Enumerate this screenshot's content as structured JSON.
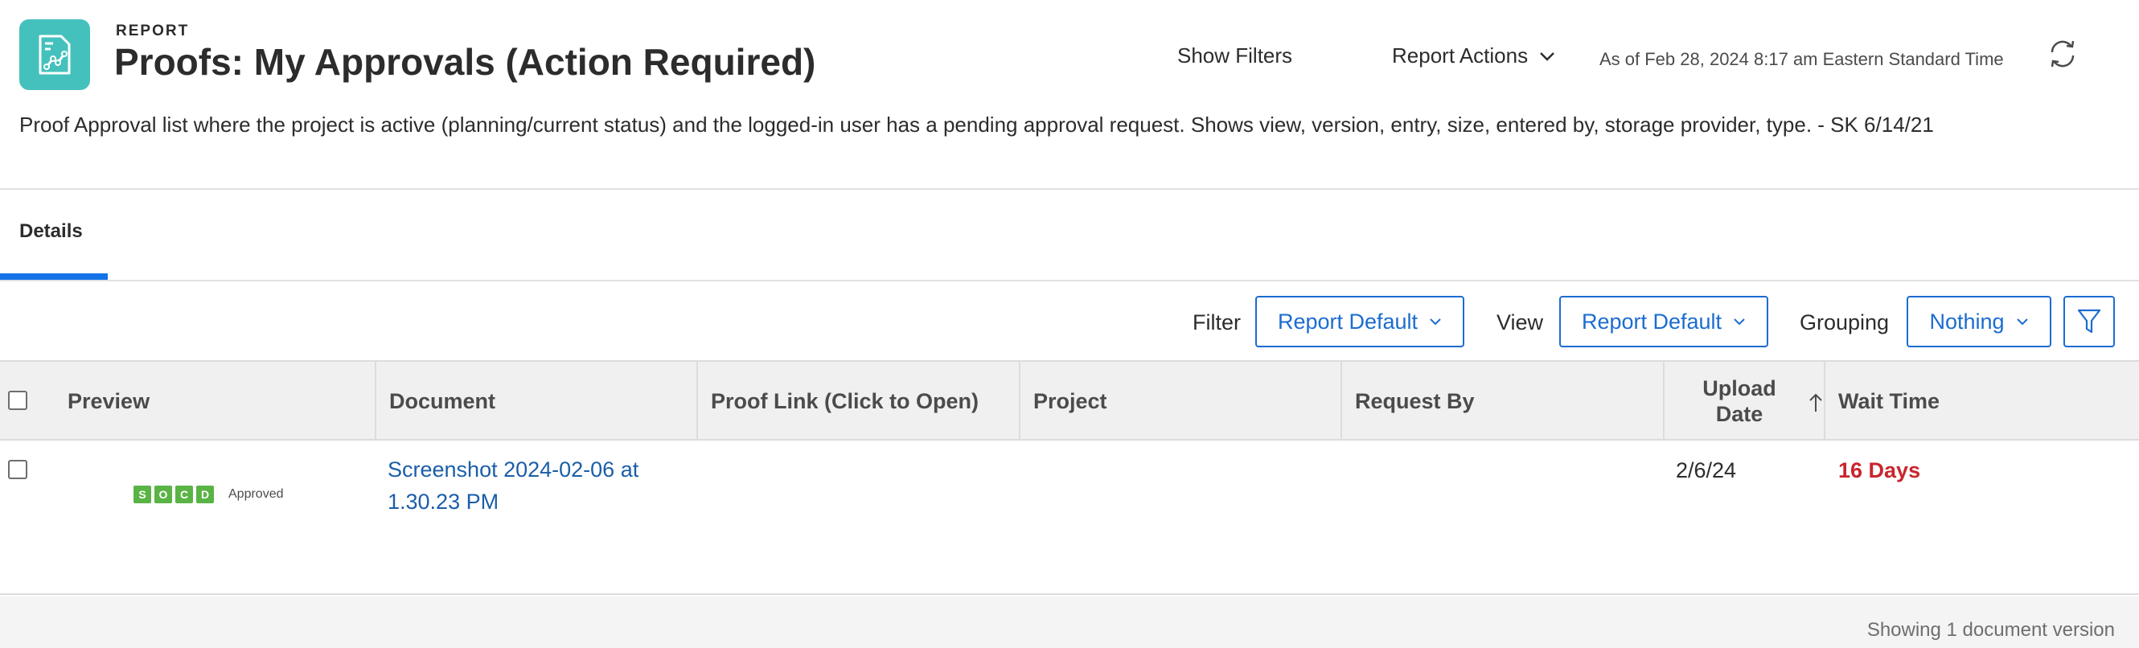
{
  "header": {
    "eyebrow": "REPORT",
    "title": "Proofs: My Approvals (Action Required)",
    "show_filters": "Show Filters",
    "report_actions": "Report Actions",
    "as_of": "As of Feb 28, 2024 8:17 am Eastern Standard Time",
    "description": "Proof Approval list where the project is active (planning/current status) and the logged-in user has a pending approval request. Shows view, version, entry, size, entered by, storage provider, type. - SK 6/14/21",
    "icon": "report-chart-icon",
    "icon_color": "#45c1bd"
  },
  "tabs": [
    {
      "label": "Details",
      "active": true
    }
  ],
  "toolbar": {
    "filter_label": "Filter",
    "filter_value": "Report Default",
    "view_label": "View",
    "view_value": "Report Default",
    "grouping_label": "Grouping",
    "grouping_value": "Nothing"
  },
  "table": {
    "columns": [
      "Preview",
      "Document",
      "Proof Link (Click to Open)",
      "Project",
      "Request By",
      "Upload Date",
      "Wait Time"
    ],
    "upload_date_sort": "ascending",
    "rows": [
      {
        "preview_badges": [
          "S",
          "O",
          "C",
          "D"
        ],
        "preview_status": "Approved",
        "document": "Screenshot 2024-02-06 at 1.30.23 PM",
        "proof_link": "",
        "project": "",
        "request_by": "",
        "upload_date": "2/6/24",
        "wait_time": "16 Days"
      }
    ]
  },
  "footer": {
    "status": "Showing 1 document version"
  },
  "colors": {
    "accent": "#1b6cd1",
    "tab_underline": "#1473e6",
    "wait_alert": "#c9252d",
    "badge_green": "#5ab345"
  }
}
